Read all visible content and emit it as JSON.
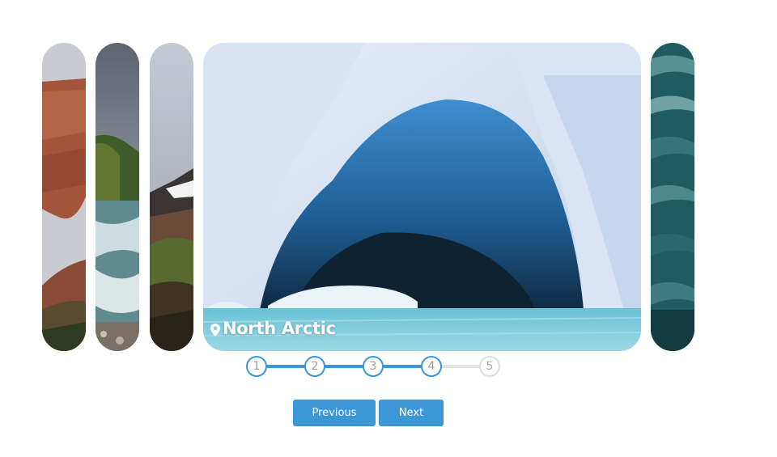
{
  "carousel": {
    "slides": [
      {
        "name": "red-rock-arch"
      },
      {
        "name": "cliff-waterfall"
      },
      {
        "name": "volcanic-hills"
      },
      {
        "name": "north-arctic",
        "caption": "North Arctic",
        "active": true
      },
      {
        "name": "ocean-waves"
      }
    ],
    "active_caption": "North Arctic",
    "caption_icon": "location-pin-icon"
  },
  "stepper": {
    "steps": [
      "1",
      "2",
      "3",
      "4",
      "5"
    ],
    "current": 4,
    "colors": {
      "active": "#3d96d6",
      "inactive": "#dedede"
    }
  },
  "buttons": {
    "previous_label": "Previous",
    "next_label": "Next",
    "color": "#3d96d6"
  }
}
